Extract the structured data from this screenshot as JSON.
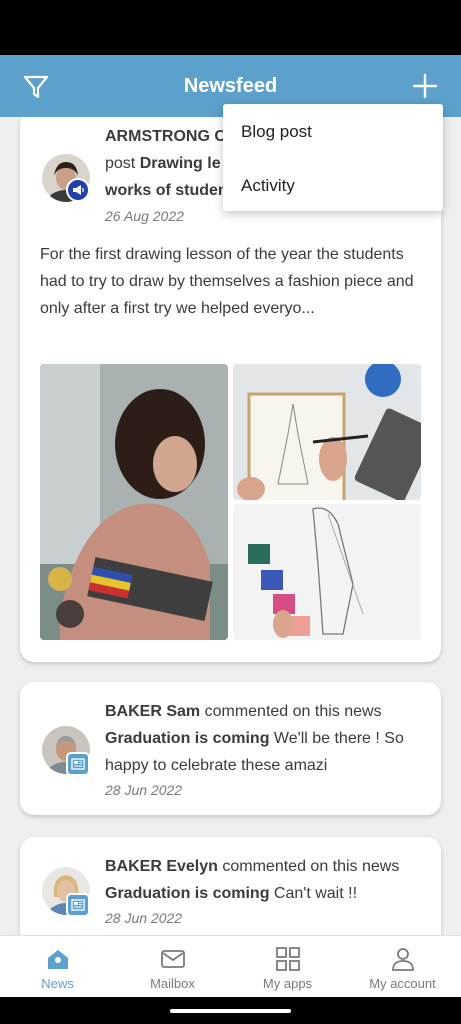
{
  "app_bar": {
    "title": "Newsfeed",
    "left_icon": "filter-icon",
    "right_icon": "plus-icon",
    "color": "#5ba1cc"
  },
  "add_menu": {
    "items": [
      {
        "label": "Blog post"
      },
      {
        "label": "Activity"
      }
    ]
  },
  "posts": [
    {
      "author": "ARMSTRONG C",
      "action_line": "post",
      "title_part1": "Drawing le",
      "title_part2": "works of studen",
      "date": "26 Aug 2022",
      "badge_icon": "megaphone-icon",
      "text": "For the first drawing lesson of the year the students had to try to draw by themselves a fashion piece and only after a first try we helped everyo..."
    },
    {
      "author": "BAKER Sam",
      "action": "commented on this news",
      "news_title": "Graduation is coming",
      "comment": "We'll be there ! So happy to celebrate these amazi",
      "date": "28 Jun 2022",
      "badge_icon": "newspaper-icon"
    },
    {
      "author": "BAKER Evelyn",
      "action": "commented on this news",
      "news_title": "Graduation is coming",
      "comment": "Can't wait !!",
      "date": "28 Jun 2022",
      "badge_icon": "newspaper-icon"
    }
  ],
  "bottom_nav": [
    {
      "label": "News",
      "icon": "home-icon",
      "active": true
    },
    {
      "label": "Mailbox",
      "icon": "mail-icon",
      "active": false
    },
    {
      "label": "My apps",
      "icon": "apps-grid-icon",
      "active": false
    },
    {
      "label": "My account",
      "icon": "person-icon",
      "active": false
    }
  ]
}
